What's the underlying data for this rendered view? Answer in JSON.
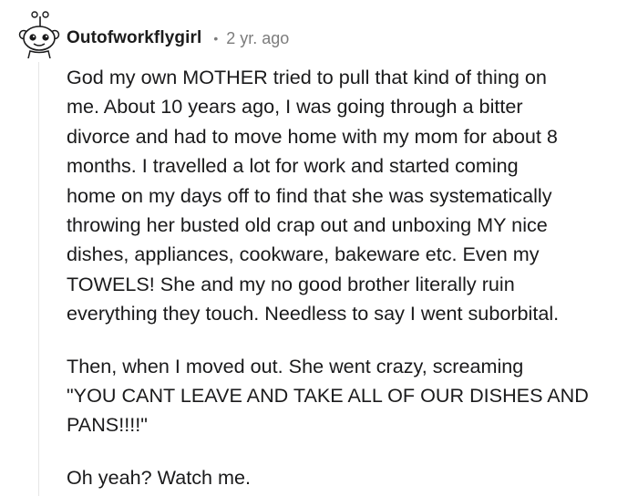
{
  "comment": {
    "username": "Outofworkflygirl",
    "separator": "•",
    "timestamp": "2 yr. ago",
    "avatar_icon": "snoo-avatar-icon",
    "paragraphs": [
      "God my own MOTHER tried to pull that kind of thing on\nme. About 10 years ago, I was going through a bitter\ndivorce and had to move home with my mom for about 8\nmonths. I travelled a lot for work and started coming\nhome on my days off to find that she was systematically\nthrowing her busted old crap out and unboxing MY nice\ndishes, appliances, cookware, bakeware etc. Even my\nTOWELS! She and my no good brother literally ruin\neverything they touch. Needless to say I went suborbital.",
      "Then, when I moved out. She went crazy, screaming\n\"YOU CANT LEAVE AND TAKE ALL OF OUR DISHES AND\nPANS!!!!\"",
      "Oh yeah? Watch me."
    ]
  },
  "colors": {
    "text": "#1a1a1b",
    "meta": "#7c7c7c",
    "thread_line": "#e6e6e6"
  }
}
